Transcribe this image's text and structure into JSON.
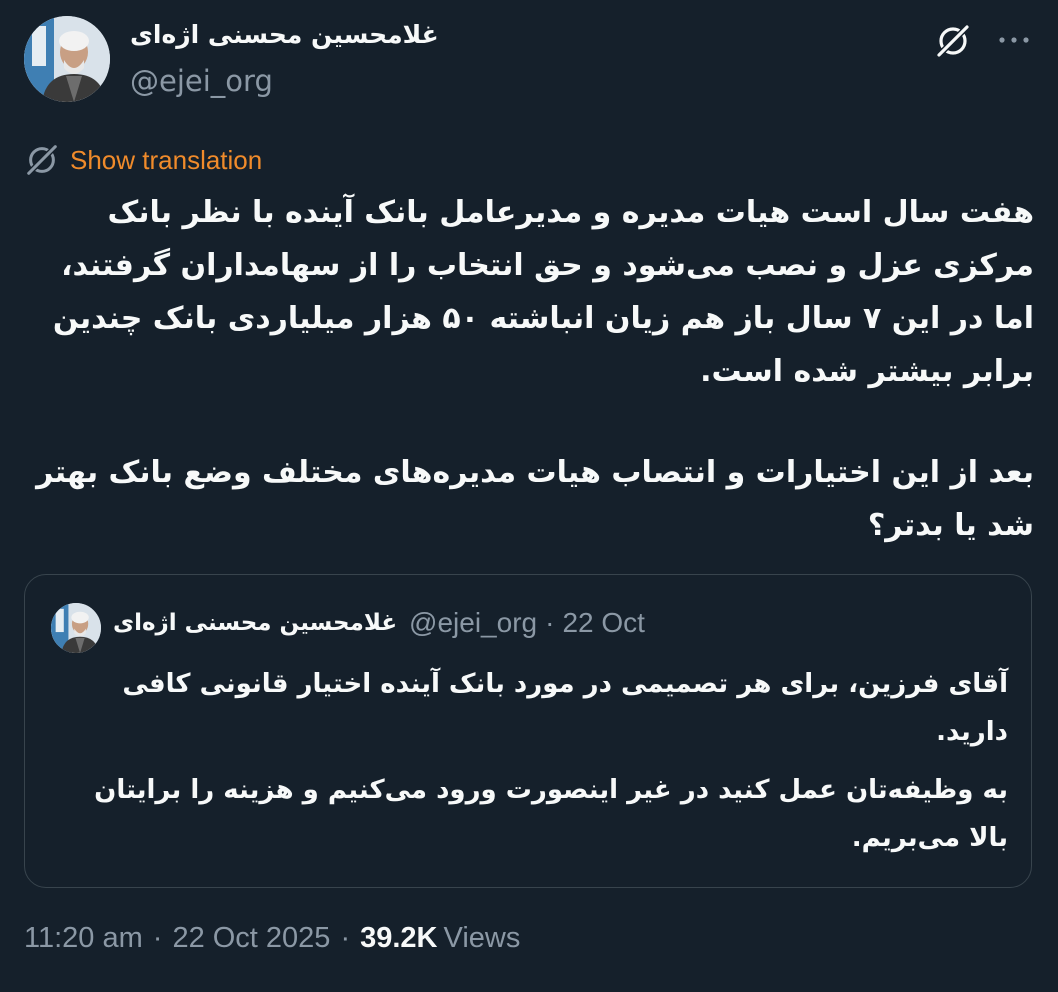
{
  "author": {
    "name": "غلامحسین محسنی اژه‌ای",
    "handle": "@ejei_org"
  },
  "translation": {
    "label": "Show translation"
  },
  "tweet": {
    "paragraph1": "هفت سال است هیات مدیره و مدیرعامل بانک آینده با نظر بانک مرکزی عزل و نصب می‌شود و حق انتخاب را از سهامداران گرفتند، اما در این ۷ سال باز هم زیان انباشته ۵۰ هزار میلیاردی بانک چندین برابر بیشتر شده است.",
    "paragraph2": "بعد از این اختیارات و انتصاب هیات مدیره‌های مختلف وضع بانک بهتر شد یا بدتر؟"
  },
  "quote": {
    "name": "غلامحسین محسنی اژه‌ای",
    "handle": "@ejei_org",
    "separator": "·",
    "date": "22 Oct",
    "paragraph1": "آقای فرزین، برای هر تصمیمی در مورد بانک آینده اختیار قانونی کافی دارید.",
    "paragraph2": "به وظیفه‌تان عمل کنید در غیر اینصورت ورود می‌کنیم و هزینه را برایتان بالا می‌بریم."
  },
  "footer": {
    "time": "11:20 am",
    "separator": "·",
    "date": "22 Oct 2025",
    "views_count": "39.2K",
    "views_label": "Views"
  },
  "icons": {
    "grok": "grok-icon",
    "more": "more-icon",
    "translate": "translate-icon"
  },
  "colors": {
    "background": "#15202b",
    "text": "#f7f9f9",
    "secondary": "#8b98a5",
    "translate_link": "#f08b2b",
    "border": "#38444d"
  }
}
